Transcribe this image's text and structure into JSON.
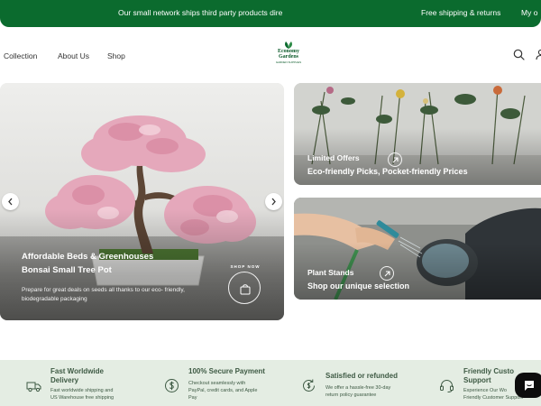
{
  "announcement": {
    "items": [
      "Our small network ships third party products dire",
      "Free shipping & returns",
      "My o"
    ]
  },
  "header": {
    "nav": [
      "Collection",
      "About Us",
      "Shop"
    ],
    "logo": {
      "line1": "Economy",
      "line2": "Gardens",
      "line3": "GARDEN SUPPLIES"
    },
    "icons": {
      "search": "search-icon",
      "account": "account-icon"
    }
  },
  "hero": {
    "subtitle": "Affordable Beds & Greenhouses",
    "title": "Bonsai Small Tree Pot",
    "description": "Prepare for great deals on seeds all thanks to our eco- friendly, biodegradable packaging",
    "badge_text": "SHOP NOW"
  },
  "cards": [
    {
      "label": "Limited Offers",
      "title": "Eco-friendly Picks, Pocket-friendly Prices"
    },
    {
      "label": "Plant Stands",
      "title": "Shop our unique selection"
    }
  ],
  "features": [
    {
      "title_1": "Fast Worldwide",
      "title_2": "Delivery",
      "desc_1": "Fast worldwide shipping and",
      "desc_2": "US Warehouse free shipping",
      "icon": "truck-icon"
    },
    {
      "title_1": "100% Secure Payment",
      "title_2": "",
      "desc_1": "Checkout seamlessly with",
      "desc_2": "PayPal, credit cards, and Apple",
      "desc_3": "Pay",
      "icon": "dollar-icon"
    },
    {
      "title_1": "Satisfied or refunded",
      "title_2": "",
      "desc_1": "We offer a hassle-free 30-day",
      "desc_2": "return policy guarantee",
      "icon": "refund-icon"
    },
    {
      "title_1": "Friendly Custo",
      "title_2": "Support",
      "desc_1": "Experience Our Wo",
      "desc_2": "Friendly Customer Support",
      "icon": "headset-icon"
    }
  ],
  "colors": {
    "brand": "#0b6b2e",
    "feature_bg": "#e4ede3",
    "feature_text": "#3e5a44"
  }
}
